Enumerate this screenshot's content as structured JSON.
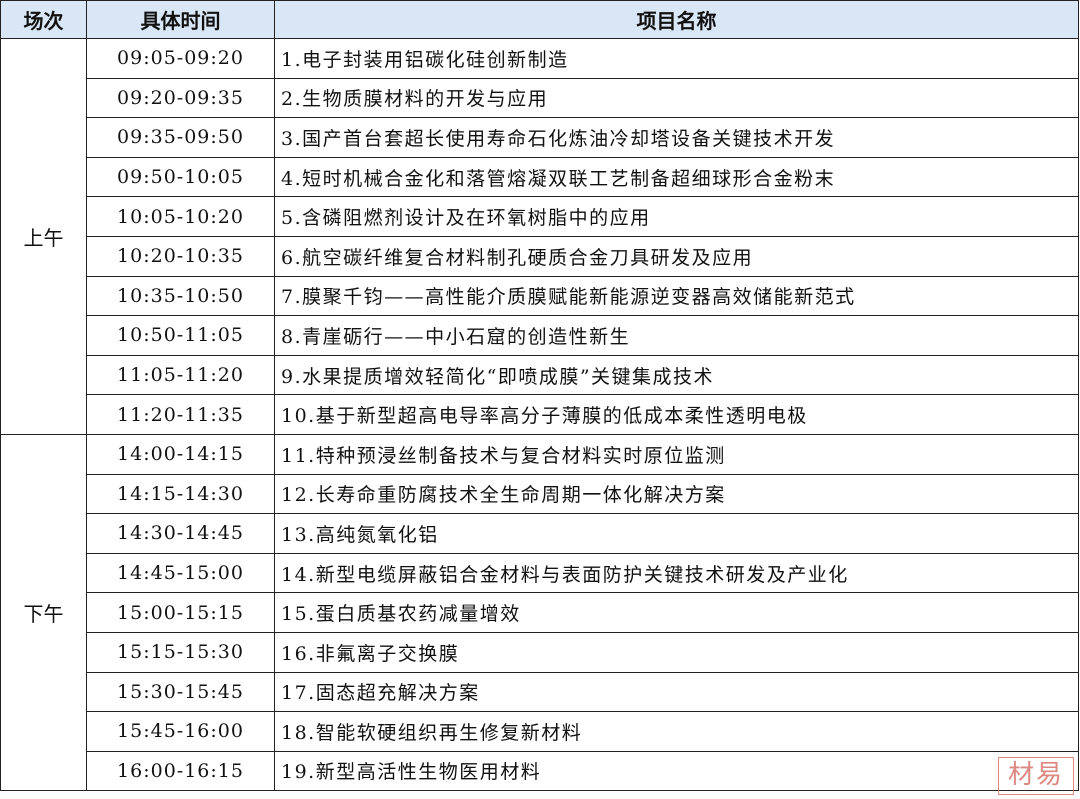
{
  "headers": {
    "session": "场次",
    "time": "具体时间",
    "project": "项目名称"
  },
  "sessions": [
    {
      "name": "上午",
      "rows": [
        {
          "time": "09:05-09:20",
          "project": "1.电子封装用铝碳化硅创新制造"
        },
        {
          "time": "09:20-09:35",
          "project": "2.生物质膜材料的开发与应用"
        },
        {
          "time": "09:35-09:50",
          "project": "3.国产首台套超长使用寿命石化炼油冷却塔设备关键技术开发"
        },
        {
          "time": "09:50-10:05",
          "project": "4.短时机械合金化和落管熔凝双联工艺制备超细球形合金粉末"
        },
        {
          "time": "10:05-10:20",
          "project": "5.含磷阻燃剂设计及在环氧树脂中的应用"
        },
        {
          "time": "10:20-10:35",
          "project": "6.航空碳纤维复合材料制孔硬质合金刀具研发及应用"
        },
        {
          "time": "10:35-10:50",
          "project": "7.膜聚千钧——高性能介质膜赋能新能源逆变器高效储能新范式"
        },
        {
          "time": "10:50-11:05",
          "project": "8.青崖砺行——中小石窟的创造性新生"
        },
        {
          "time": "11:05-11:20",
          "project": "9.水果提质增效轻简化“即喷成膜”关键集成技术"
        },
        {
          "time": "11:20-11:35",
          "project": "10.基于新型超高电导率高分子薄膜的低成本柔性透明电极"
        }
      ]
    },
    {
      "name": "下午",
      "rows": [
        {
          "time": "14:00-14:15",
          "project": "11.特种预浸丝制备技术与复合材料实时原位监测"
        },
        {
          "time": "14:15-14:30",
          "project": "12.长寿命重防腐技术全生命周期一体化解决方案"
        },
        {
          "time": "14:30-14:45",
          "project": "13.高纯氮氧化铝"
        },
        {
          "time": "14:45-15:00",
          "project": "14.新型电缆屏蔽铝合金材料与表面防护关键技术研发及产业化"
        },
        {
          "time": "15:00-15:15",
          "project": "15.蛋白质基农药减量增效"
        },
        {
          "time": "15:15-15:30",
          "project": "16.非氟离子交换膜"
        },
        {
          "time": "15:30-15:45",
          "project": "17.固态超充解决方案"
        },
        {
          "time": "15:45-16:00",
          "project": "18.智能软硬组织再生修复新材料"
        },
        {
          "time": "16:00-16:15",
          "project": "19.新型高活性生物医用材料"
        }
      ]
    }
  ],
  "stamp_text": "材易",
  "colors": {
    "header_bg": "#d9e6f5",
    "border": "#222222",
    "stamp": "#d8746a"
  }
}
